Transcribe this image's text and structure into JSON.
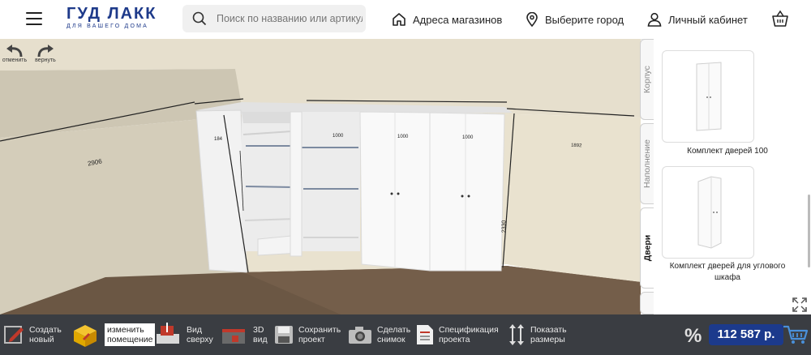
{
  "header": {
    "logo_main": "ГУД ЛАКК",
    "logo_sub": "ДЛЯ ВАШЕГО ДОМА",
    "search_placeholder": "Поиск по названию или артикулу",
    "nav": [
      "Адреса магазинов",
      "Выберите город",
      "Личный кабинет"
    ]
  },
  "history": {
    "undo": "отменить",
    "redo": "вернуть"
  },
  "dimensions": {
    "left_wall": "2906",
    "top_depth": "184",
    "sec1": "1000",
    "sec2": "1000",
    "sec3": "1000",
    "right_wall": "1892",
    "height": "2330"
  },
  "tabs": [
    "Корпус",
    "Наполнение",
    "Двери"
  ],
  "products": [
    {
      "caption": "Комплект дверей 100"
    },
    {
      "caption": "Комплект дверей для углового шкафа"
    }
  ],
  "toolbar": [
    {
      "l1": "Создать",
      "l2": "новый"
    },
    {
      "l1": "изменить",
      "l2": "помещение"
    },
    {
      "l1": "Вид",
      "l2": "сверху"
    },
    {
      "l1": "3D",
      "l2": "вид"
    },
    {
      "l1": "Сохранить",
      "l2": "проект"
    },
    {
      "l1": "Сделать",
      "l2": "снимок"
    },
    {
      "l1": "Спецификация",
      "l2": "проекта"
    },
    {
      "l1": "Показать",
      "l2": "размеры"
    }
  ],
  "discount_symbol": "%",
  "price": "112 587 р.",
  "colors": {
    "brand": "#1e3a8a",
    "price_bg": "#1c3a8c",
    "toolbar_bg": "#3a3d42",
    "wall": "#e9e1cd",
    "floor": "#6b5744"
  }
}
